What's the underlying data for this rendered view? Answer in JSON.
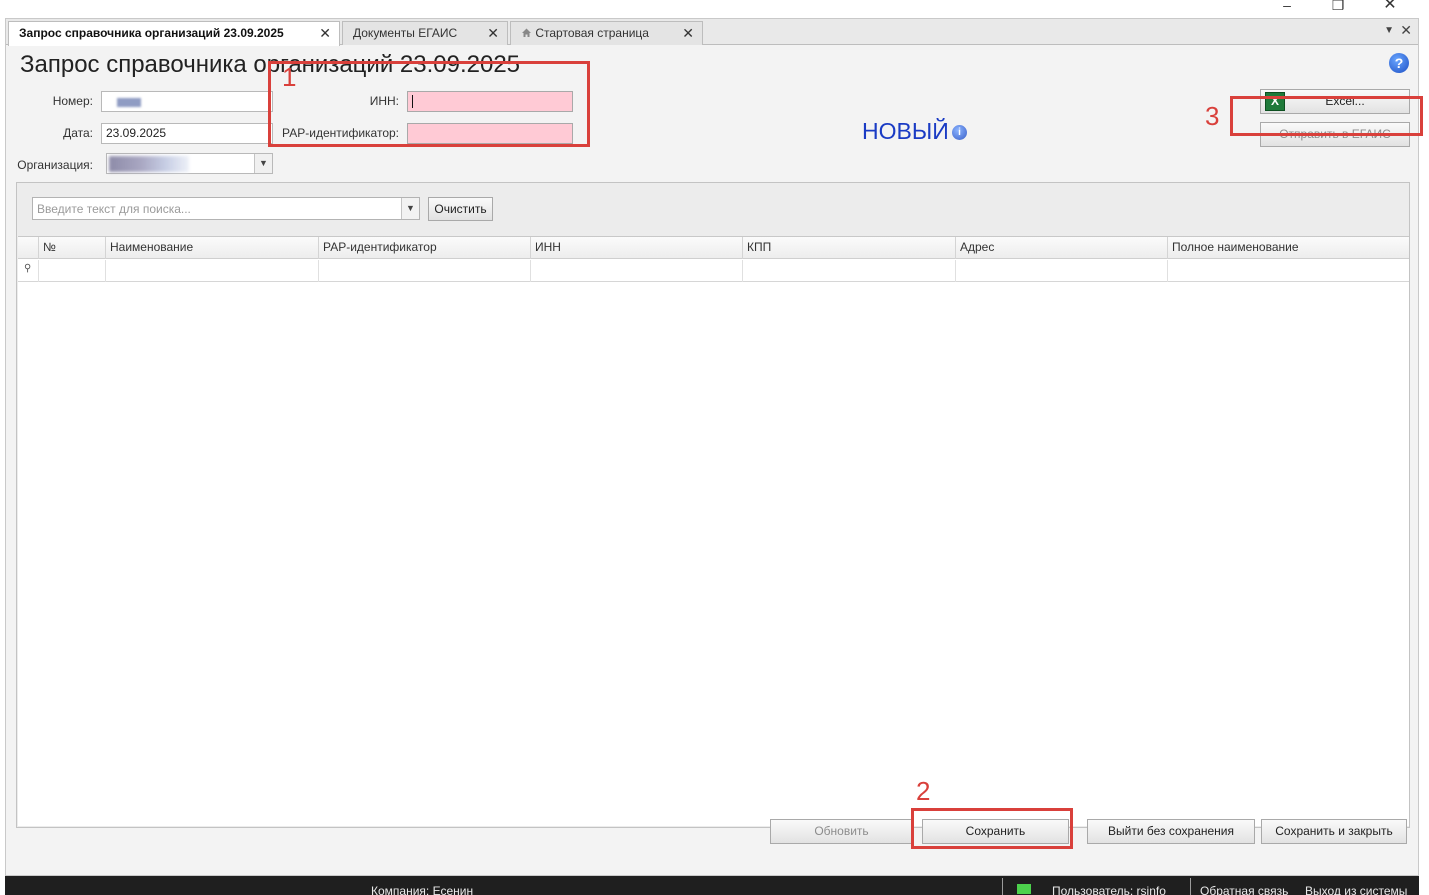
{
  "window": {
    "minimize": "–",
    "maximize": "❐",
    "close": "✕"
  },
  "tabs": [
    {
      "label": "Запрос справочника организаций 23.09.2025",
      "active": true
    },
    {
      "label": "Документы ЕГАИС",
      "active": false
    },
    {
      "label": "Стартовая страница",
      "icon": "home-icon",
      "active": false
    }
  ],
  "tab_close_glyph": "✕",
  "tabbar_menu_glyph": "▼",
  "page": {
    "title": "Запрос справочника организаций 23.09.2025",
    "help": "?"
  },
  "form": {
    "number_label": "Номер:",
    "date_label": "Дата:",
    "date_value": "23.09.2025",
    "org_label": "Организация:",
    "inn_label": "ИНН:",
    "rar_label": "РАР-идентификатор:"
  },
  "status": {
    "text": "НОВЫЙ",
    "info": "i",
    "color": "#1a3bc4"
  },
  "buttons": {
    "excel": "Excel...",
    "excel_icon": "X",
    "send_egais": "Отправить в ЕГАИС",
    "clear": "Очистить",
    "refresh": "Обновить",
    "save": "Сохранить",
    "exit_no_save": "Выйти без сохранения",
    "save_close": "Сохранить и закрыть"
  },
  "search": {
    "placeholder": "Введите текст для поиска...",
    "dropdown": "▼"
  },
  "table": {
    "columns": [
      "№",
      "Наименование",
      "РАР-идентификатор",
      "ИНН",
      "КПП",
      "Адрес",
      "Полное наименование"
    ],
    "filter_icon": "⚲",
    "rows": []
  },
  "annotations": {
    "one": "1",
    "two": "2",
    "three": "3",
    "color": "#d9403b"
  },
  "statusbar": {
    "company": "Компания: Есенин",
    "user": "Пользователь: rsinfo",
    "feedback": "Обратная связь",
    "logout": "Выход из системы"
  }
}
